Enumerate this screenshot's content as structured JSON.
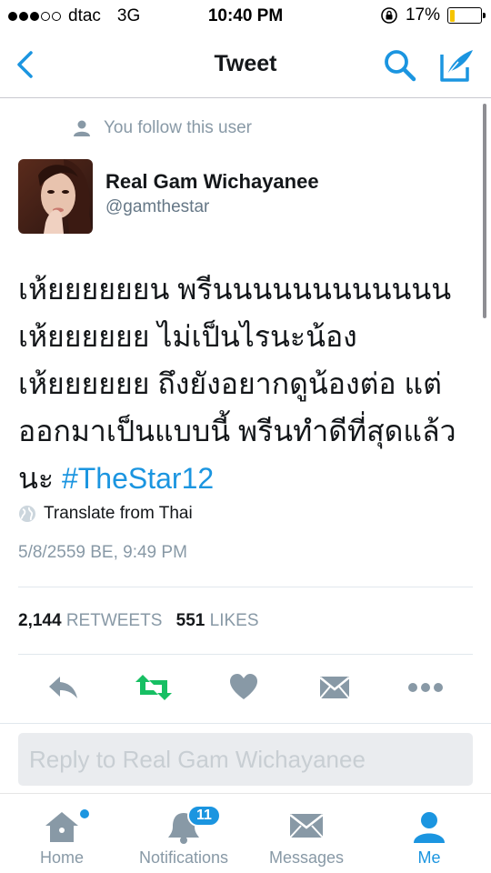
{
  "status_bar": {
    "carrier": "dtac",
    "network": "3G",
    "time": "10:40 PM",
    "battery_percent": "17%",
    "battery_level": 0.17,
    "signal_bars": 3,
    "signal_max": 5
  },
  "nav": {
    "title": "Tweet",
    "back_icon": "chevron-left-icon",
    "search_icon": "search-icon",
    "compose_icon": "compose-icon"
  },
  "tweet": {
    "context": "You follow this user",
    "author_name": "Real Gam Wichayanee",
    "author_handle": "@gamthestar",
    "text_lines": [
      "เห้ยยยยยยน พรีนนนนนนนนนนนน",
      "เห้ยยยยยย ไม่เป็นไรนะน้อง",
      "เห้ยยยยยย ถึงยังอยากดูน้องต่อ แต่",
      "ออกมาเป็นแบบนี้ พรีนทำดีที่สุดแล้ว"
    ],
    "last_line_prefix": "นะ",
    "hashtag": "#TheStar12",
    "translate_label": "Translate from Thai",
    "timestamp": "5/8/2559 BE, 9:49 PM",
    "retweet_count": "2,144",
    "retweet_label": "RETWEETS",
    "like_count": "551",
    "like_label": "LIKES"
  },
  "actions": [
    "reply-icon",
    "retweet-icon",
    "heart-icon",
    "message-icon",
    "more-icon"
  ],
  "reply": {
    "placeholder": "Reply to Real Gam Wichayanee"
  },
  "tabs": [
    {
      "label": "Home",
      "icon": "home-icon"
    },
    {
      "label": "Notifications",
      "icon": "bell-icon",
      "badge": "11"
    },
    {
      "label": "Messages",
      "icon": "envelope-icon"
    },
    {
      "label": "Me",
      "icon": "person-icon",
      "active": true
    }
  ],
  "colors": {
    "accent": "#1b95e0",
    "retweet_green": "#17bf63",
    "icon_gray": "#8899a6",
    "battery_yellow": "#f5c400"
  }
}
